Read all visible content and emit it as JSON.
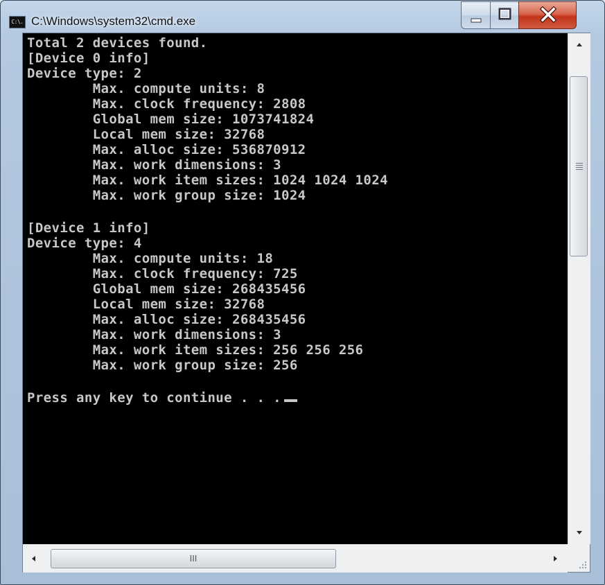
{
  "window": {
    "title": "C:\\Windows\\system32\\cmd.exe",
    "icon_label": "C:\\."
  },
  "controls": {
    "minimize": "minimize-icon",
    "maximize": "maximize-icon",
    "close": "close-icon",
    "close_color": "#c1341c"
  },
  "console": {
    "background": "#000000",
    "foreground": "#c8c8c8",
    "lines": [
      "Total 2 devices found.",
      "[Device 0 info]",
      "Device type: 2",
      "        Max. compute units: 8",
      "        Max. clock frequency: 2808",
      "        Global mem size: 1073741824",
      "        Local mem size: 32768",
      "        Max. alloc size: 536870912",
      "        Max. work dimensions: 3",
      "        Max. work item sizes: 1024 1024 1024",
      "        Max. work group size: 1024",
      "",
      "[Device 1 info]",
      "Device type: 4",
      "        Max. compute units: 18",
      "        Max. clock frequency: 725",
      "        Global mem size: 268435456",
      "        Local mem size: 32768",
      "        Max. alloc size: 268435456",
      "        Max. work dimensions: 3",
      "        Max. work item sizes: 256 256 256",
      "        Max. work group size: 256",
      "",
      "Press any key to continue . . ."
    ]
  },
  "scrollbars": {
    "horizontal_thumb_grip": "III"
  }
}
